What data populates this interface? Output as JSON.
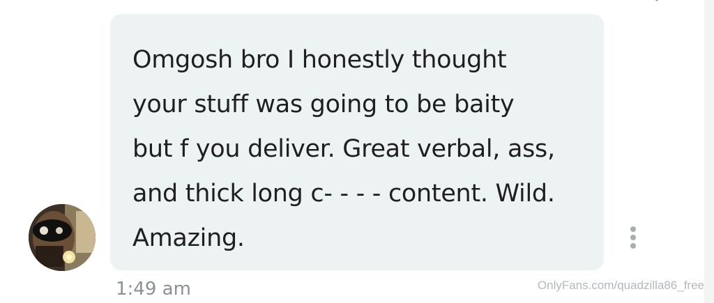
{
  "message": {
    "text": "Omgosh bro I honestly thought\nyour stuff was going to be baity\nbut f you deliver. Great verbal, ass,\nand thick long c- - - - content. Wild.\nAmazing.",
    "time": "1:49 am"
  },
  "watermark": {
    "text": "OnlyFans.com/quadzilla86_free"
  },
  "icons": {
    "more": "more-vertical-icon",
    "top": "chevron-down-icon"
  },
  "colors": {
    "bubble": "#edf3f3",
    "text": "#1f1f1f",
    "time": "#8a9096",
    "dots": "#a8adb1"
  }
}
